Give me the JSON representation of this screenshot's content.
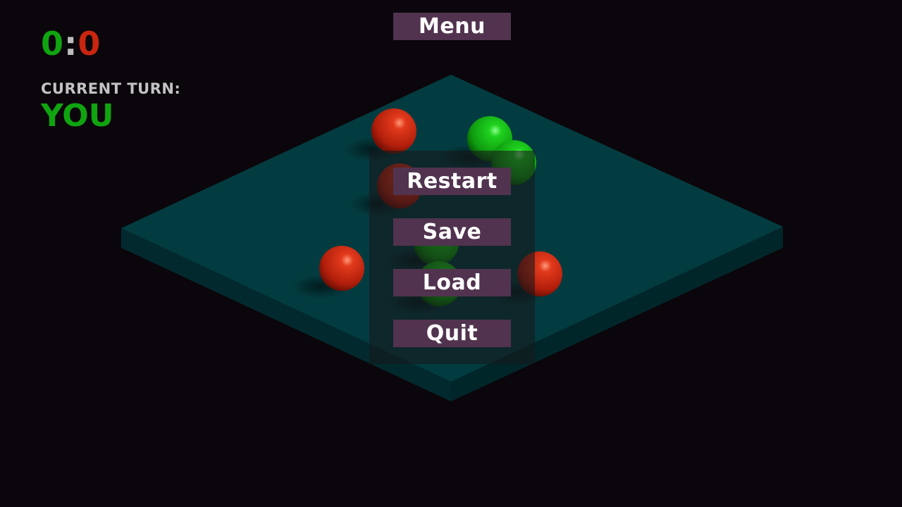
{
  "hud": {
    "score": {
      "player": "0",
      "separator": ":",
      "opponent": "0"
    },
    "turn_label": "CURRENT TURN:",
    "turn_value": "YOU"
  },
  "menu_button_label": "Menu",
  "pause_menu": {
    "items": [
      {
        "label": "Restart"
      },
      {
        "label": "Save"
      },
      {
        "label": "Load"
      },
      {
        "label": "Quit"
      }
    ]
  },
  "board": {
    "balls": [
      {
        "color": "red"
      },
      {
        "color": "green"
      },
      {
        "color": "green"
      },
      {
        "color": "red"
      },
      {
        "color": "red"
      },
      {
        "color": "green"
      },
      {
        "color": "green"
      },
      {
        "color": "red"
      }
    ]
  },
  "colors": {
    "background": "#0b060b",
    "board_top": "#033c40",
    "board_side": "#022a2e",
    "player": "#10a410",
    "opponent": "#c8260f",
    "button": "#51334f",
    "label": "#c3c3c3"
  }
}
